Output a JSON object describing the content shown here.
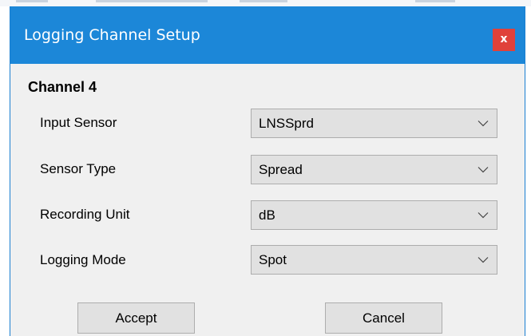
{
  "dialog": {
    "title": "Logging Channel Setup",
    "close_label": "x",
    "channel_heading": "Channel 4"
  },
  "fields": [
    {
      "label": "Input Sensor",
      "value": "LNSSprd"
    },
    {
      "label": "Sensor Type",
      "value": "Spread"
    },
    {
      "label": "Recording Unit",
      "value": "dB"
    },
    {
      "label": "Logging Mode",
      "value": "Spot"
    }
  ],
  "buttons": {
    "accept_label": "Accept",
    "cancel_label": "Cancel"
  },
  "colors": {
    "titlebar": "#1c87d8",
    "close_button": "#e0413a",
    "dialog_background": "#f0f0f0"
  }
}
